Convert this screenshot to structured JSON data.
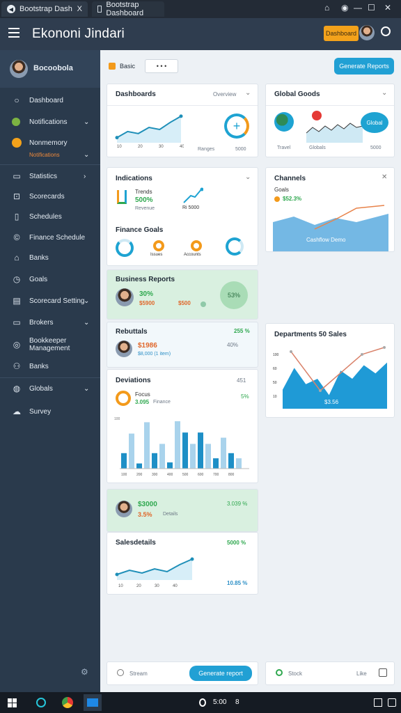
{
  "browser": {
    "tab1_title": "Bootstrap Dash",
    "tab1_close": "X",
    "tab2_title": "Bootstrap Dashboard"
  },
  "app": {
    "title": "Ekononi Jindari",
    "header_button": "Dashboard"
  },
  "sidebar": {
    "user": "Bocoobola",
    "items": [
      {
        "label": "Dashboard",
        "icon": "search-icon"
      },
      {
        "label": "Notifications",
        "icon": "leaf-icon"
      },
      {
        "label": "Nonmemory",
        "icon": "orange-circle-icon",
        "sub": "Notifications"
      },
      {
        "label": "Statistics",
        "icon": "window-icon"
      },
      {
        "label": "Scorecards",
        "icon": "chart-icon"
      },
      {
        "label": "Schedules",
        "icon": "document-icon"
      },
      {
        "label": "Finance Schedule",
        "icon": "copyright-icon"
      },
      {
        "label": "Banks",
        "icon": "home-icon"
      },
      {
        "label": "Goals",
        "icon": "clock-icon"
      },
      {
        "label": "Scorecard Setting",
        "icon": "table-icon"
      },
      {
        "label": "Brokers",
        "icon": "monitor-icon"
      },
      {
        "label": "Bookkeeper Management",
        "icon": "circle-icon"
      },
      {
        "label": "Banks",
        "icon": "people-icon"
      },
      {
        "label": "Globals",
        "icon": "globe-icon"
      },
      {
        "label": "Survey",
        "icon": "cloud-icon"
      }
    ]
  },
  "toolbar": {
    "chip_label": "Basic",
    "chip_icons": "• • •",
    "action_button": "Generate Reports"
  },
  "cards": {
    "trend": {
      "title": "Dashboards",
      "meta": "Overview",
      "x_labels": [
        "10",
        "20",
        "30",
        "40"
      ],
      "foot_left": "Ranges",
      "foot_right": "5000"
    },
    "global": {
      "title": "Global Goods",
      "badge": "Global",
      "axis_left": "Travel",
      "axis_mid": "Globals",
      "axis_right": "5000"
    },
    "kpi": {
      "title": "Indications",
      "sub1": "Trends",
      "value": "500%",
      "sub2": "Revenue",
      "right_small": "Ri 5000"
    },
    "donuts": {
      "title": "Finance Goals",
      "labels": [
        "",
        "Issues",
        "Accounts",
        ""
      ]
    },
    "channels": {
      "title": "Channels",
      "sub": "Goals",
      "value": "$52.3%",
      "area_label": "Cashflow Demo"
    },
    "person_green": {
      "title": "Business Reports",
      "percent": "30%",
      "value": "$5900",
      "unit": "$500",
      "ring": "53%"
    },
    "person_white": {
      "title": "Rebuttals",
      "value": "$1986",
      "sub": "$8,000 (1 item)",
      "right": "255 %",
      "right2": "40%"
    },
    "barcard": {
      "title": "Deviations",
      "meta": "451",
      "ring_label": "Focus",
      "ring_value": "3.095",
      "ring_sub": "Finance",
      "right": "5%",
      "y_top": "100",
      "x_labels": [
        "100",
        "200",
        "300",
        "400",
        "500",
        "600",
        "700",
        "800"
      ]
    },
    "big_area": {
      "title": "Departments 50 Sales",
      "y_labels": [
        "100",
        "60",
        "50",
        "10"
      ],
      "center": "$3.56"
    },
    "person_green2": {
      "value": "$3000",
      "value2": "3.5%",
      "sub": "Details",
      "right": "3.039 %"
    },
    "salesline": {
      "title": "Salesdetails",
      "right": "5000 %",
      "x_labels": [
        "10",
        "20",
        "30",
        "40"
      ],
      "foot": "10.85 %"
    }
  },
  "footer": {
    "left_label": "Stream",
    "left_button": "Generate report",
    "right_label": "Stock",
    "right_meta": "Like"
  },
  "taskbar": {
    "time": "5:00",
    "extra": "8"
  },
  "colors": {
    "accent": "#21a0d4",
    "orange": "#f3a21b",
    "green": "#2fa84f",
    "sidebar": "#2a3a4c"
  },
  "chart_data": [
    {
      "type": "line",
      "name": "trend",
      "x": [
        10,
        15,
        20,
        25,
        30,
        35,
        40
      ],
      "values": [
        10,
        22,
        18,
        30,
        26,
        40,
        52
      ],
      "ylim": [
        0,
        60
      ]
    },
    {
      "type": "bar",
      "name": "deviations",
      "categories": [
        "100",
        "",
        "200",
        "",
        "300",
        "",
        "400",
        "",
        "500",
        "",
        "600",
        "",
        "700",
        "",
        "800",
        ""
      ],
      "values": [
        30,
        68,
        10,
        90,
        30,
        48,
        12,
        92,
        70,
        48,
        70,
        48,
        20,
        60,
        30,
        20
      ],
      "ylim": [
        0,
        100
      ]
    },
    {
      "type": "area",
      "name": "departments",
      "values": [
        30,
        70,
        40,
        50,
        20,
        65,
        50,
        75,
        60,
        80
      ],
      "ylim": [
        0,
        100
      ]
    }
  ]
}
